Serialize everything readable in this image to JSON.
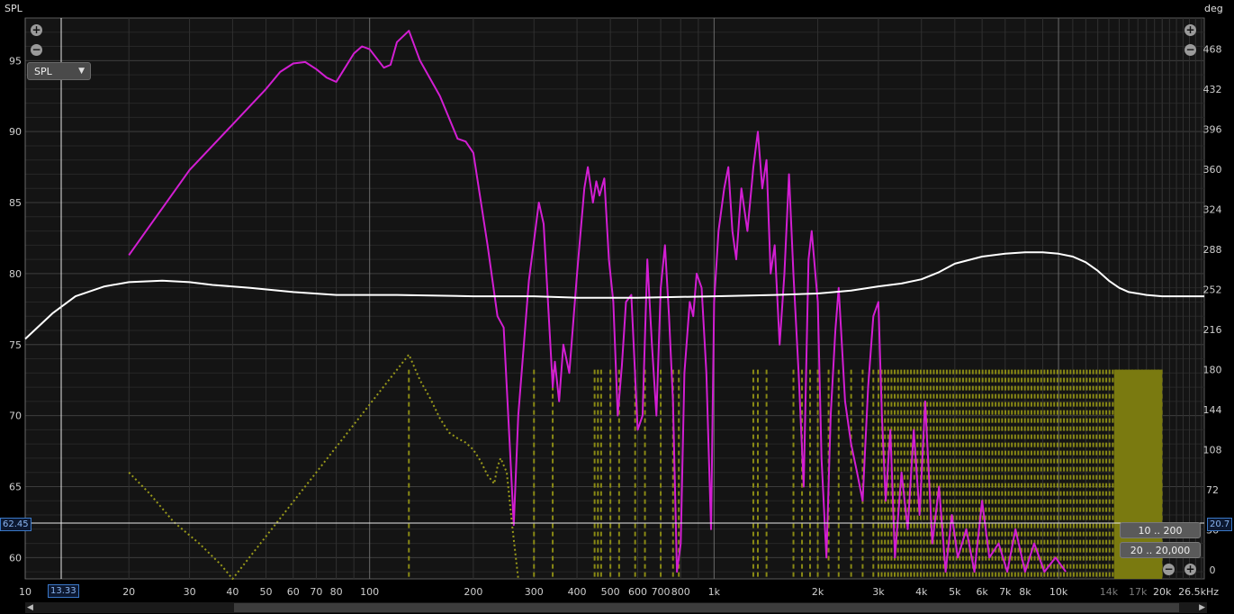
{
  "left_axis_title": "SPL",
  "right_axis_title": "deg",
  "y_ticks_left": [
    "95",
    "90",
    "85",
    "80",
    "75",
    "70",
    "65",
    "60"
  ],
  "y_ticks_right": [
    "468",
    "432",
    "396",
    "360",
    "324",
    "288",
    "252",
    "216",
    "180",
    "144",
    "108",
    "72",
    "36",
    "0"
  ],
  "x_ticks": [
    "10",
    "20",
    "30",
    "40",
    "50",
    "60",
    "70",
    "80",
    "100",
    "200",
    "300",
    "400",
    "500",
    "600",
    "700",
    "800",
    "1k",
    "2k",
    "3k",
    "4k",
    "5k",
    "6k",
    "7k",
    "8k",
    "10k",
    "14k",
    "17k",
    "20k",
    "26.5kHz"
  ],
  "x_ticks_dim": [
    "14k",
    "17k"
  ],
  "select_value": "SPL",
  "cursor_left_value": "62.45",
  "cursor_right_value": "20.7",
  "cursor_x_value": "13.33",
  "range_buttons": [
    "10 .. 200",
    "20 .. 20,000"
  ],
  "icons": {
    "zoom_in": "plus-circle-icon",
    "zoom_out": "minus-circle-icon",
    "dropdown": "caret-down-icon"
  },
  "colors": {
    "magenta": "#d21ed2",
    "white": "#ffffff",
    "olive": "#9a9a1a",
    "grid": "#3a3a3a",
    "cursor": "#3a78c8"
  },
  "chart_data": {
    "type": "line",
    "x_scale": "log",
    "xlim": [
      10,
      26500
    ],
    "ylim_left": [
      58.5,
      98
    ],
    "ylim_right": [
      -8,
      496
    ],
    "grid": true,
    "series": [
      {
        "axis": "left",
        "color": "#d21ed2",
        "points": [
          [
            20,
            81.3
          ],
          [
            30,
            87.3
          ],
          [
            40,
            90.5
          ],
          [
            50,
            93
          ],
          [
            55,
            94.2
          ],
          [
            60,
            94.8
          ],
          [
            65,
            94.9
          ],
          [
            70,
            94.4
          ],
          [
            75,
            93.8
          ],
          [
            80,
            93.5
          ],
          [
            90,
            95.5
          ],
          [
            95,
            96
          ],
          [
            100,
            95.8
          ],
          [
            110,
            94.5
          ],
          [
            115,
            94.7
          ],
          [
            120,
            96.3
          ],
          [
            130,
            97.1
          ],
          [
            140,
            95
          ],
          [
            160,
            92.5
          ],
          [
            180,
            89.5
          ],
          [
            190,
            89.3
          ],
          [
            200,
            88.5
          ],
          [
            220,
            82
          ],
          [
            235,
            77
          ],
          [
            245,
            76.2
          ],
          [
            255,
            68
          ],
          [
            262,
            62.3
          ],
          [
            270,
            70
          ],
          [
            290,
            79.5
          ],
          [
            310,
            85
          ],
          [
            320,
            83.5
          ],
          [
            340,
            72
          ],
          [
            345,
            73.8
          ],
          [
            355,
            71
          ],
          [
            365,
            75
          ],
          [
            380,
            73
          ],
          [
            400,
            80
          ],
          [
            420,
            86
          ],
          [
            430,
            87.5
          ],
          [
            445,
            85
          ],
          [
            455,
            86.5
          ],
          [
            465,
            85.5
          ],
          [
            480,
            86.7
          ],
          [
            495,
            81
          ],
          [
            510,
            78
          ],
          [
            525,
            70
          ],
          [
            540,
            73.5
          ],
          [
            555,
            78
          ],
          [
            575,
            78.5
          ],
          [
            600,
            69
          ],
          [
            620,
            70
          ],
          [
            640,
            81
          ],
          [
            660,
            75
          ],
          [
            680,
            70
          ],
          [
            700,
            79
          ],
          [
            720,
            82
          ],
          [
            740,
            77
          ],
          [
            760,
            71
          ],
          [
            780,
            59
          ],
          [
            800,
            61
          ],
          [
            820,
            73
          ],
          [
            850,
            78
          ],
          [
            870,
            77
          ],
          [
            890,
            80
          ],
          [
            920,
            79
          ],
          [
            950,
            73
          ],
          [
            980,
            62
          ],
          [
            1000,
            78
          ],
          [
            1030,
            83
          ],
          [
            1070,
            86
          ],
          [
            1100,
            87.5
          ],
          [
            1130,
            83
          ],
          [
            1160,
            81
          ],
          [
            1200,
            86
          ],
          [
            1250,
            83
          ],
          [
            1300,
            87.5
          ],
          [
            1340,
            90
          ],
          [
            1380,
            86
          ],
          [
            1420,
            88
          ],
          [
            1460,
            80
          ],
          [
            1500,
            82
          ],
          [
            1550,
            75
          ],
          [
            1600,
            80
          ],
          [
            1650,
            87
          ],
          [
            1700,
            80
          ],
          [
            1760,
            73
          ],
          [
            1820,
            65
          ],
          [
            1880,
            81
          ],
          [
            1920,
            83
          ],
          [
            2000,
            78
          ],
          [
            2050,
            67
          ],
          [
            2120,
            60
          ],
          [
            2180,
            70
          ],
          [
            2250,
            76
          ],
          [
            2300,
            79
          ],
          [
            2400,
            71
          ],
          [
            2500,
            68
          ],
          [
            2600,
            66
          ],
          [
            2700,
            64
          ],
          [
            2800,
            72
          ],
          [
            2900,
            77
          ],
          [
            3000,
            78
          ],
          [
            3070,
            70
          ],
          [
            3150,
            64
          ],
          [
            3250,
            69
          ],
          [
            3350,
            60
          ],
          [
            3500,
            66
          ],
          [
            3650,
            62
          ],
          [
            3800,
            69
          ],
          [
            3950,
            63
          ],
          [
            4100,
            71
          ],
          [
            4300,
            61
          ],
          [
            4500,
            65
          ],
          [
            4700,
            59
          ],
          [
            4900,
            63
          ],
          [
            5100,
            60
          ],
          [
            5400,
            62
          ],
          [
            5700,
            59
          ],
          [
            6000,
            64
          ],
          [
            6300,
            60
          ],
          [
            6700,
            61
          ],
          [
            7100,
            59
          ],
          [
            7500,
            62
          ],
          [
            8000,
            59
          ],
          [
            8500,
            61
          ],
          [
            9100,
            59
          ],
          [
            9800,
            60
          ],
          [
            10500,
            59
          ]
        ]
      },
      {
        "axis": "left",
        "color": "#ffffff",
        "points": [
          [
            10,
            75.4
          ],
          [
            12,
            77.2
          ],
          [
            14,
            78.4
          ],
          [
            17,
            79.1
          ],
          [
            20,
            79.4
          ],
          [
            25,
            79.5
          ],
          [
            30,
            79.4
          ],
          [
            35,
            79.2
          ],
          [
            45,
            79.0
          ],
          [
            60,
            78.7
          ],
          [
            80,
            78.5
          ],
          [
            120,
            78.5
          ],
          [
            200,
            78.4
          ],
          [
            300,
            78.4
          ],
          [
            400,
            78.3
          ],
          [
            600,
            78.3
          ],
          [
            1000,
            78.4
          ],
          [
            1500,
            78.5
          ],
          [
            2000,
            78.6
          ],
          [
            2500,
            78.8
          ],
          [
            3000,
            79.1
          ],
          [
            3500,
            79.3
          ],
          [
            4000,
            79.6
          ],
          [
            4500,
            80.1
          ],
          [
            5000,
            80.7
          ],
          [
            6000,
            81.2
          ],
          [
            7000,
            81.4
          ],
          [
            8000,
            81.5
          ],
          [
            9000,
            81.5
          ],
          [
            10000,
            81.4
          ],
          [
            11000,
            81.2
          ],
          [
            12000,
            80.8
          ],
          [
            13000,
            80.2
          ],
          [
            14000,
            79.5
          ],
          [
            15000,
            79
          ],
          [
            16000,
            78.7
          ],
          [
            18000,
            78.5
          ],
          [
            20000,
            78.4
          ],
          [
            26500,
            78.4
          ]
        ]
      },
      {
        "axis": "right",
        "color": "#9a9a1a",
        "style": "dotted",
        "points": [
          [
            20,
            66
          ],
          [
            23,
            64.5
          ],
          [
            27,
            62.5
          ],
          [
            32,
            61
          ],
          [
            37,
            59.5
          ],
          [
            40,
            58.5
          ],
          [
            130,
            74.3
          ],
          [
            140,
            72.5
          ],
          [
            150,
            71.2
          ],
          [
            160,
            69.8
          ],
          [
            170,
            68.8
          ],
          [
            180,
            68.4
          ],
          [
            190,
            68.1
          ],
          [
            200,
            67.6
          ],
          [
            210,
            66.8
          ],
          [
            220,
            65.8
          ],
          [
            230,
            65.2
          ],
          [
            235,
            66.4
          ],
          [
            240,
            67.0
          ],
          [
            250,
            66.0
          ],
          [
            260,
            62.0
          ],
          [
            270,
            58.5
          ]
        ]
      }
    ]
  }
}
